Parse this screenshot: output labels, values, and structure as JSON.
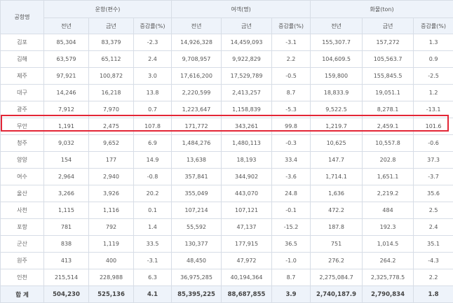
{
  "header": {
    "airport_col": "공항명",
    "groups": [
      "운항(편수)",
      "여객(명)",
      "화물(ton)"
    ],
    "subcols": [
      "전년",
      "금년",
      "증감률(%)"
    ]
  },
  "rows": [
    {
      "airport": "김포",
      "cells": [
        "85,304",
        "83,379",
        "-2.3",
        "14,926,328",
        "14,459,093",
        "-3.1",
        "155,307.7",
        "157,272",
        "1.3"
      ]
    },
    {
      "airport": "김해",
      "cells": [
        "63,579",
        "65,112",
        "2.4",
        "9,708,957",
        "9,922,829",
        "2.2",
        "104,609.5",
        "105,563.7",
        "0.9"
      ]
    },
    {
      "airport": "제주",
      "cells": [
        "97,921",
        "100,872",
        "3.0",
        "17,616,200",
        "17,529,789",
        "-0.5",
        "159,800",
        "155,845.5",
        "-2.5"
      ]
    },
    {
      "airport": "대구",
      "cells": [
        "14,246",
        "16,218",
        "13.8",
        "2,220,599",
        "2,413,257",
        "8.7",
        "18,833.9",
        "19,051.1",
        "1.2"
      ]
    },
    {
      "airport": "광주",
      "cells": [
        "7,912",
        "7,970",
        "0.7",
        "1,223,647",
        "1,158,839",
        "-5.3",
        "9,522.5",
        "8,278.1",
        "-13.1"
      ]
    },
    {
      "airport": "무안",
      "cells": [
        "1,191",
        "2,475",
        "107.8",
        "171,772",
        "343,261",
        "99.8",
        "1,219.7",
        "2,459.1",
        "101.6"
      ]
    },
    {
      "airport": "청주",
      "cells": [
        "9,032",
        "9,652",
        "6.9",
        "1,484,276",
        "1,480,113",
        "-0.3",
        "10,625",
        "10,557.8",
        "-0.6"
      ]
    },
    {
      "airport": "양양",
      "cells": [
        "154",
        "177",
        "14.9",
        "13,638",
        "18,193",
        "33.4",
        "147.7",
        "202.8",
        "37.3"
      ]
    },
    {
      "airport": "여수",
      "cells": [
        "2,964",
        "2,940",
        "-0.8",
        "357,841",
        "344,902",
        "-3.6",
        "1,714.1",
        "1,651.1",
        "-3.7"
      ]
    },
    {
      "airport": "울산",
      "cells": [
        "3,266",
        "3,926",
        "20.2",
        "355,049",
        "443,070",
        "24.8",
        "1,636",
        "2,219.2",
        "35.6"
      ]
    },
    {
      "airport": "사천",
      "cells": [
        "1,115",
        "1,116",
        "0.1",
        "107,214",
        "107,121",
        "-0.1",
        "472.2",
        "484",
        "2.5"
      ]
    },
    {
      "airport": "포항",
      "cells": [
        "781",
        "792",
        "1.4",
        "55,592",
        "47,137",
        "-15.2",
        "187.8",
        "192.3",
        "2.4"
      ]
    },
    {
      "airport": "군산",
      "cells": [
        "838",
        "1,119",
        "33.5",
        "130,377",
        "177,915",
        "36.5",
        "751",
        "1,014.5",
        "35.1"
      ]
    },
    {
      "airport": "원주",
      "cells": [
        "413",
        "400",
        "-3.1",
        "48,450",
        "47,972",
        "-1.0",
        "276.2",
        "264.2",
        "-4.3"
      ]
    },
    {
      "airport": "인천",
      "cells": [
        "215,514",
        "228,988",
        "6.3",
        "36,975,285",
        "40,194,364",
        "8.7",
        "2,275,084.7",
        "2,325,778.5",
        "2.2"
      ]
    }
  ],
  "total": {
    "label": "합 계",
    "cells": [
      "504,230",
      "525,136",
      "4.1",
      "85,395,225",
      "88,687,855",
      "3.9",
      "2,740,187.9",
      "2,790,834",
      "1.8"
    ]
  },
  "highlight_color": "#e32636"
}
